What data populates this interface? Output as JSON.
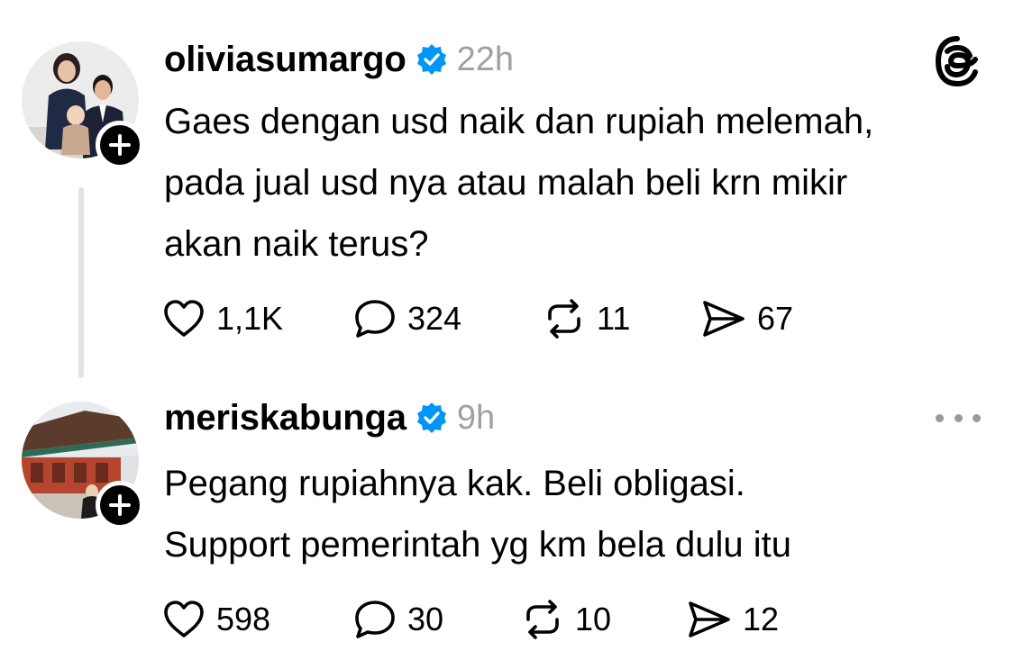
{
  "posts": [
    {
      "username": "oliviasumargo",
      "verified": true,
      "time": "22h",
      "text_lines": [
        "Gaes dengan usd naik dan rupiah melemah,",
        "pada jual usd nya atau malah beli krn mikir",
        "akan naik terus?"
      ],
      "likes": "1,1K",
      "replies": "324",
      "reposts": "11",
      "shares": "67"
    },
    {
      "username": "meriskabunga",
      "verified": true,
      "time": "9h",
      "text_lines": [
        "Pegang rupiahnya kak. Beli obligasi.",
        "Support pemerintah yg km bela dulu itu"
      ],
      "likes": "598",
      "replies": "30",
      "reposts": "10",
      "shares": "12"
    }
  ],
  "icons": {
    "app_logo": "threads-logo-icon",
    "verified": "verified-badge-icon",
    "like": "heart-icon",
    "reply": "comment-bubble-icon",
    "repost": "repost-icon",
    "share": "send-icon",
    "follow": "plus-icon",
    "more": "more-horizontal-icon"
  },
  "colors": {
    "verified_badge": "#0095f6",
    "timestamp": "#a0a0a0",
    "thread_line": "#e3e3e3"
  }
}
